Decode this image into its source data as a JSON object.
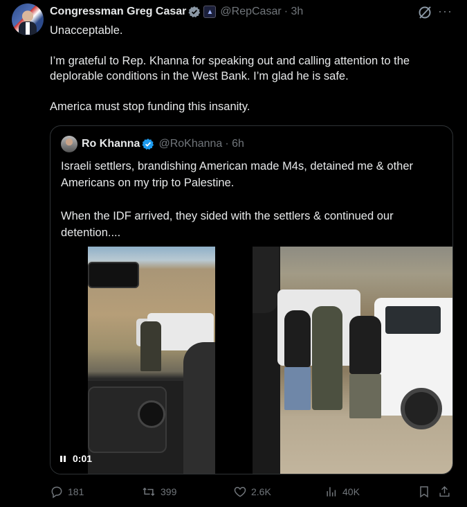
{
  "author": {
    "name": "Congressman Greg Casar",
    "handle": "@RepCasar",
    "time": "· 3h",
    "affiliation_badge": "US House"
  },
  "tweet": {
    "paragraphs": [
      "Unacceptable.",
      "I’m grateful to Rep. Khanna for speaking out and calling attention to the deplorable conditions in the West Bank. I’m glad he is safe.",
      "America must stop funding this insanity."
    ]
  },
  "quote": {
    "name": "Ro Khanna",
    "handle": "@RoKhanna",
    "time": "· 6h",
    "paragraphs": [
      "Israeli settlers, brandishing American made M4s, detained me & other Americans on my trip to Palestine.",
      "When the IDF arrived, they sided with the settlers & continued our detention...."
    ],
    "video_time": "0:01"
  },
  "actions": {
    "replies": "181",
    "reposts": "399",
    "likes": "2.6K",
    "views": "40K"
  },
  "colors": {
    "background": "#000000",
    "text": "#e7e9ea",
    "muted": "#71767b",
    "verified": "#1d9bf0",
    "border": "#2f3336"
  },
  "icons": [
    "verified-badge-icon",
    "grok-icon",
    "more-icon",
    "reply-icon",
    "repost-icon",
    "like-icon",
    "views-icon",
    "bookmark-icon",
    "share-icon",
    "pause-icon"
  ]
}
